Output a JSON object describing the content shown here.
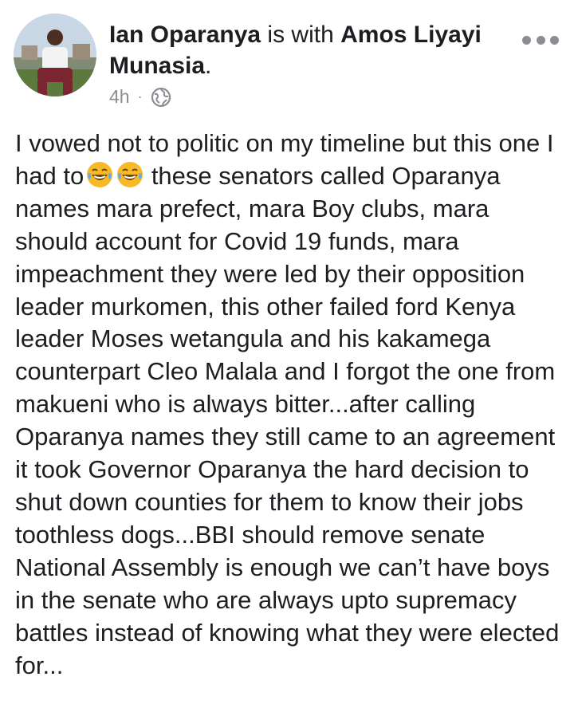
{
  "post": {
    "author_name": "Ian Oparanya",
    "with_text": " is with ",
    "tagged_name": "Amos Liyayi Munasia",
    "end_punct": ".",
    "timestamp": "4h",
    "separator": "·",
    "privacy_icon": "globe-icon",
    "more_icon": "more-options-icon",
    "text_part1": "I vowed not to politic on my timeline but this one I had to",
    "emojis": [
      "😂",
      "😂"
    ],
    "text_part2": " these senators called Oparanya names mara prefect, mara Boy clubs, mara should account for Covid 19 funds, mara impeachment they were led by their opposition leader murkomen, this other failed ford Kenya leader Moses wetangula and his kakamega counterpart Cleo Malala and I forgot the one from makueni who is always bitter...after calling Oparanya names they still came to an agreement it took Governor Oparanya the hard decision to shut down counties for them to know their jobs toothless dogs...BBI should remove senate National Assembly is enough we can’t have boys in the senate who are always upto supremacy battles instead of knowing what they were elected for..."
  },
  "colors": {
    "text": "#1c1e21",
    "muted": "#8a8d91",
    "background": "#ffffff"
  }
}
